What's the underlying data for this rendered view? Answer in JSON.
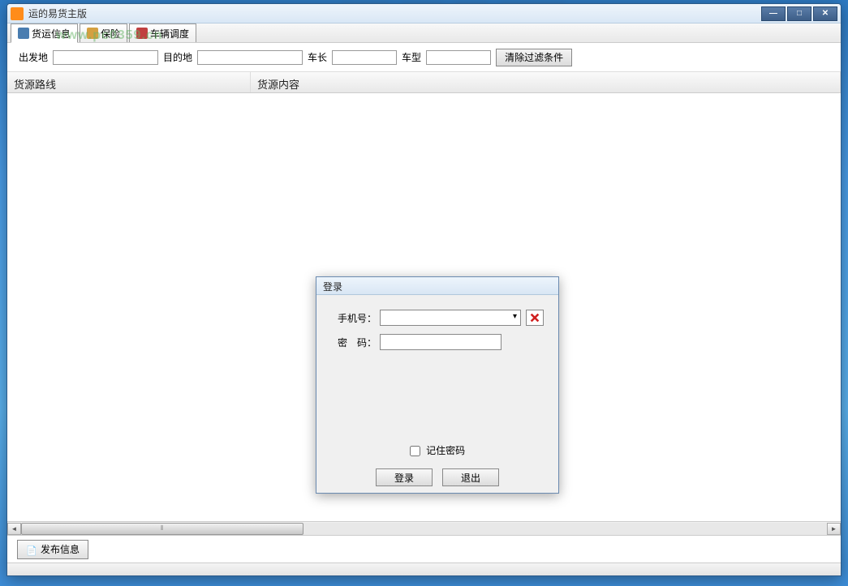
{
  "window": {
    "title": "运的易货主版"
  },
  "tabs": {
    "freight": "货运信息",
    "insurance": "保险",
    "dispatch": "车辆调度"
  },
  "watermark": "www.pc0359.cn",
  "filters": {
    "departure_label": "出发地",
    "destination_label": "目的地",
    "length_label": "车长",
    "type_label": "车型",
    "clear_label": "清除过滤条件"
  },
  "columns": {
    "route": "货源路线",
    "content": "货源内容"
  },
  "bottom": {
    "publish_label": "发布信息"
  },
  "login": {
    "title": "登录",
    "phone_label": "手机号：",
    "password_label": "密　码：",
    "remember_label": "记住密码",
    "login_btn": "登录",
    "exit_btn": "退出"
  }
}
